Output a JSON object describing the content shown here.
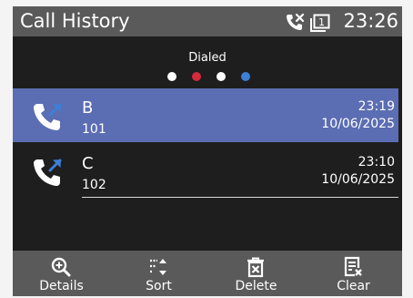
{
  "header": {
    "title": "Call History",
    "clock": "23:26",
    "missed_call_icon": "phone-missed-icon",
    "line_icon": "line-1-icon",
    "line_number": "1"
  },
  "filter": {
    "label": "Dialed",
    "pages": [
      {
        "color": "#ffffff"
      },
      {
        "color": "#d42a3b"
      },
      {
        "color": "#ffffff"
      },
      {
        "color": "#3d7fd6"
      }
    ]
  },
  "calls": [
    {
      "name": "B",
      "number": "101",
      "time": "23:19",
      "date": "10/06/2025",
      "selected": true,
      "icon": "outgoing-call-icon"
    },
    {
      "name": "C",
      "number": "102",
      "time": "23:10",
      "date": "10/06/2025",
      "selected": false,
      "icon": "outgoing-call-icon"
    }
  ],
  "softkeys": [
    {
      "label": "Details",
      "icon": "zoom-in-icon"
    },
    {
      "label": "Sort",
      "icon": "sort-icon"
    },
    {
      "label": "Delete",
      "icon": "trash-icon"
    },
    {
      "label": "Clear",
      "icon": "clear-list-icon"
    }
  ],
  "colors": {
    "background": "#1e1e1e",
    "bars": "#5a5a5a",
    "selection": "#5b6db3"
  }
}
